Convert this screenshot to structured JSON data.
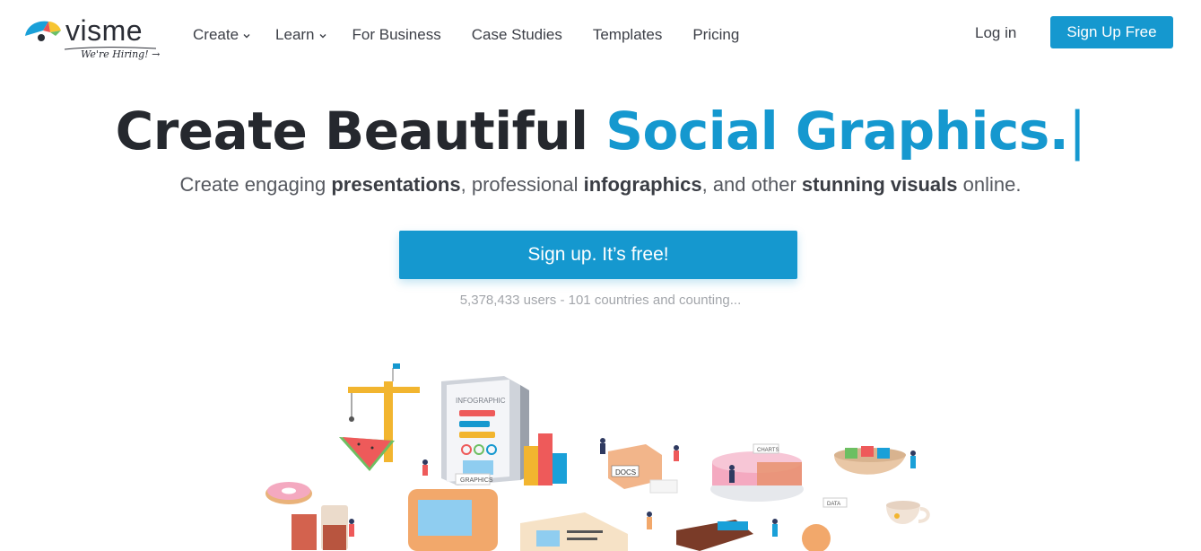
{
  "brand": {
    "name": "visme",
    "hiring": "We're Hiring! →",
    "accent_color": "#1598cf"
  },
  "nav": {
    "items": [
      {
        "label": "Create",
        "has_dropdown": true
      },
      {
        "label": "Learn",
        "has_dropdown": true
      },
      {
        "label": "For Business",
        "has_dropdown": false
      },
      {
        "label": "Case Studies",
        "has_dropdown": false
      },
      {
        "label": "Templates",
        "has_dropdown": false
      },
      {
        "label": "Pricing",
        "has_dropdown": false
      }
    ],
    "login": "Log in",
    "signup": "Sign Up Free"
  },
  "hero": {
    "title_part1": "Create Beautiful",
    "title_part2": "Social Graphics.",
    "cursor": "|",
    "sub": {
      "t1": "Create engaging ",
      "b1": "presentations",
      "t2": ", professional ",
      "b2": "infographics",
      "t3": ", and other ",
      "b3": "stunning visuals",
      "t4": " online."
    },
    "cta": "Sign up. It’s free!",
    "stats": "5,378,433 users - 101 countries and counting..."
  },
  "illustration": {
    "labels": {
      "infographic": "INFOGRAPHIC",
      "graphics": "GRAPHICS",
      "docs": "DOCS",
      "charts": "CHARTS",
      "data": "DATA"
    }
  }
}
